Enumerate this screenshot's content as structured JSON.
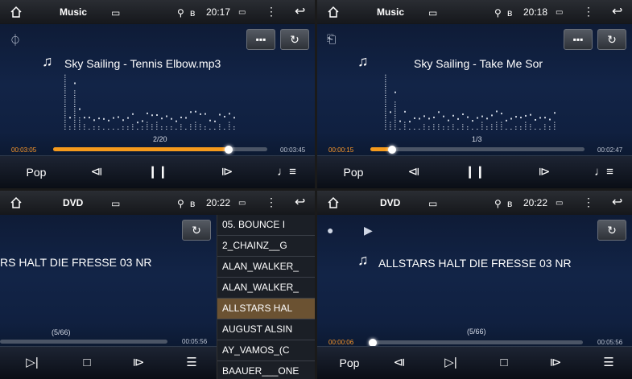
{
  "panels": [
    {
      "status": {
        "app": "Music",
        "time": "20:17"
      },
      "title": "Sky Sailing - Tennis Elbow.mp3",
      "counter": "2/20",
      "time_current": "00:03:05",
      "time_total": "00:03:45",
      "progress": 0.82,
      "controls": {
        "eq_label": "Pop"
      }
    },
    {
      "status": {
        "app": "Music",
        "time": "20:18"
      },
      "title": "Sky Sailing - Take Me Sor",
      "counter": "1/3",
      "time_current": "00:00:15",
      "time_total": "00:02:47",
      "progress": 0.1,
      "controls": {
        "eq_label": "Pop"
      }
    },
    {
      "status": {
        "app": "DVD",
        "time": "20:22"
      },
      "title": "RS HALT DIE FRESSE 03 NR",
      "counter": "(5/66)",
      "time_total": "00:05:56",
      "progress": 0.0,
      "playlist": [
        "05. BOUNCE I",
        "2_CHAINZ__G",
        "ALAN_WALKER_",
        "ALAN_WALKER_",
        "ALLSTARS HAL",
        "AUGUST ALSIN",
        "AY_VAMOS_(C",
        "BAAUER___ONE"
      ],
      "playlist_selected": 4
    },
    {
      "status": {
        "app": "DVD",
        "time": "20:22"
      },
      "title": "ALLSTARS HALT DIE FRESSE 03 NR",
      "counter": "(5/66)",
      "time_current": "00:00:06",
      "time_total": "00:05:56",
      "progress": 0.02,
      "controls": {
        "eq_label": "Pop"
      }
    }
  ],
  "icons": {
    "home": "home-icon",
    "gallery": "gallery-icon",
    "location": "location-pin-icon",
    "bluetooth": "bluetooth-icon",
    "battery": "battery-icon",
    "menu": "more-vertical-icon",
    "back": "back-arrow-icon",
    "repeat": "repeat-icon",
    "equalizer": "equalizer-icon",
    "prev": "previous-track-icon",
    "pause": "pause-icon",
    "next": "next-track-icon",
    "playlist": "playlist-icon",
    "stop": "stop-icon",
    "usb": "usb-icon",
    "sd": "sd-card-icon",
    "disc": "disc-icon",
    "play": "play-icon"
  },
  "colors": {
    "accent": "#f59a1c",
    "time_current": "#ff9a2a",
    "playlist_selected": "#6b5232"
  }
}
